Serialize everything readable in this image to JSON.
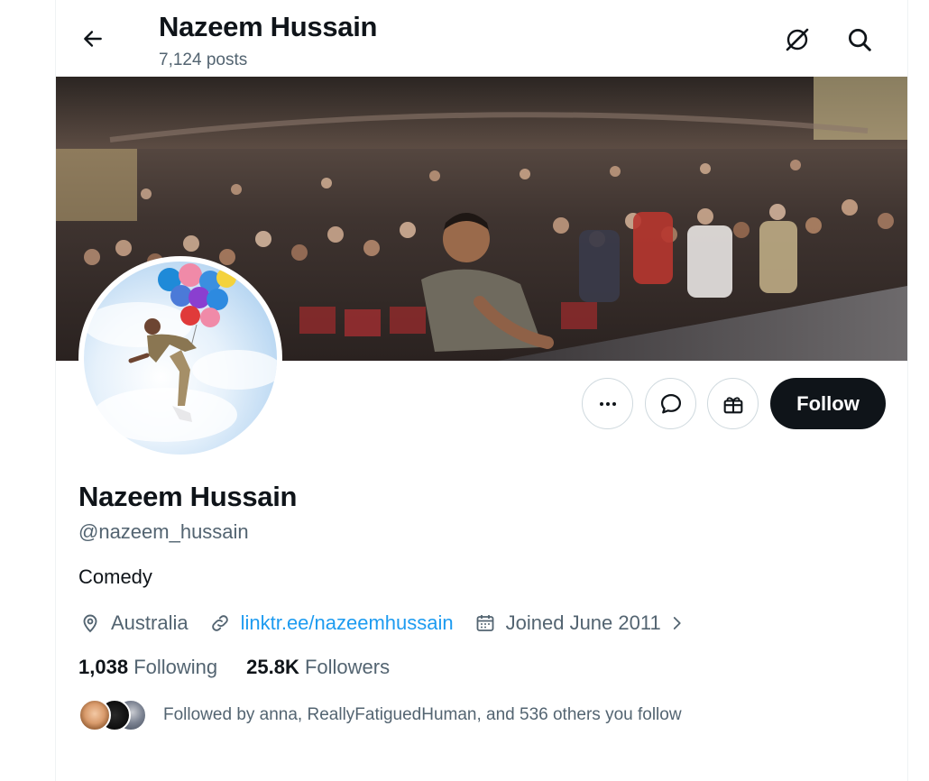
{
  "header": {
    "back_icon": "arrow-left-icon",
    "title": "Nazeem Hussain",
    "posts_count": "7,124 posts",
    "grok_icon": "grok-icon",
    "search_icon": "search-icon"
  },
  "actions": {
    "more_icon": "more-horizontal-icon",
    "message_icon": "message-icon",
    "gift_icon": "gift-icon",
    "follow_label": "Follow"
  },
  "profile": {
    "name": "Nazeem Hussain",
    "handle": "@nazeem_hussain",
    "bio": "Comedy",
    "location": "Australia",
    "website": "linktr.ee/nazeemhussain",
    "joined": "Joined June 2011",
    "following_count": "1,038",
    "following_label": "Following",
    "followers_count": "25.8K",
    "followers_label": "Followers",
    "followed_by": "Followed by anna, ReallyFatiguedHuman, and 536 others you follow"
  },
  "colors": {
    "text_primary": "#0f1419",
    "text_secondary": "#536471",
    "link": "#1d9bf0",
    "button_dark": "#0f1419",
    "border": "#cfd9de"
  }
}
